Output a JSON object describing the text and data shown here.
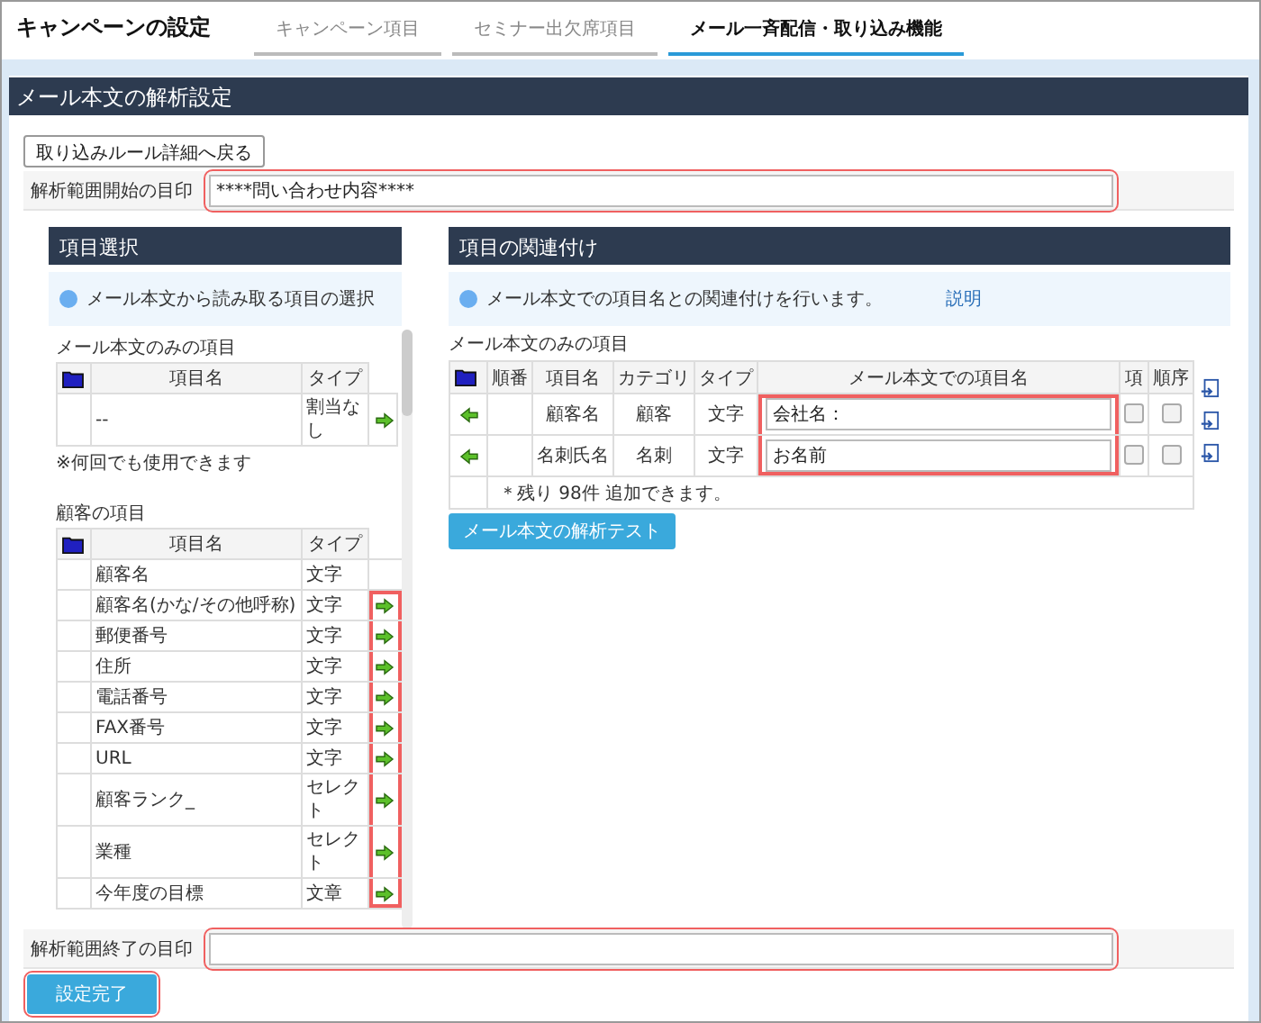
{
  "page_title": "キャンペーンの設定",
  "tabs": [
    {
      "label": "キャンペーン項目",
      "selected": false
    },
    {
      "label": "セミナー出欠席項目",
      "selected": false
    },
    {
      "label": "メール一斉配信・取り込み機能",
      "selected": true
    }
  ],
  "section_title": "メール本文の解析設定",
  "back_button": "取り込みルール詳細へ戻る",
  "start_marker": {
    "label": "解析範囲開始の目印",
    "value": "****問い合わせ内容****",
    "highlighted": true
  },
  "item_selection": {
    "title": "項目選択",
    "info": "メール本文から読み取る項目の選択",
    "mail_only": {
      "heading": "メール本文のみの項目",
      "columns": [
        "項目名",
        "タイプ"
      ],
      "rows": [
        {
          "name": "--",
          "type": "割当なし",
          "arrow": true,
          "highlighted": false
        }
      ],
      "note": "※何回でも使用できます"
    },
    "customer": {
      "heading": "顧客の項目",
      "columns": [
        "項目名",
        "タイプ"
      ],
      "rows": [
        {
          "name": "顧客名",
          "type": "文字",
          "arrow": false,
          "highlighted": false
        },
        {
          "name": "顧客名(かな/その他呼称)",
          "type": "文字",
          "arrow": true,
          "highlighted": true
        },
        {
          "name": "郵便番号",
          "type": "文字",
          "arrow": true,
          "highlighted": true
        },
        {
          "name": "住所",
          "type": "文字",
          "arrow": true,
          "highlighted": true
        },
        {
          "name": "電話番号",
          "type": "文字",
          "arrow": true,
          "highlighted": true
        },
        {
          "name": "FAX番号",
          "type": "文字",
          "arrow": true,
          "highlighted": true
        },
        {
          "name": "URL",
          "type": "文字",
          "arrow": true,
          "highlighted": true
        },
        {
          "name": "顧客ランク_",
          "type": "セレクト",
          "arrow": true,
          "highlighted": true
        },
        {
          "name": "業種",
          "type": "セレクト",
          "arrow": true,
          "highlighted": true
        },
        {
          "name": "今年度の目標",
          "type": "文章",
          "arrow": true,
          "highlighted": true
        }
      ]
    }
  },
  "mapping": {
    "title": "項目の関連付け",
    "info": "メール本文での項目名との関連付けを行います。",
    "help_link": "説明",
    "heading": "メール本文のみの項目",
    "columns": [
      "順番",
      "項目名",
      "カテゴリ",
      "タイプ",
      "メール本文での項目名",
      "項",
      "順序"
    ],
    "rows": [
      {
        "name": "顧客名",
        "category": "顧客",
        "type": "文字",
        "field": "会社名：",
        "item_checked": false,
        "order_checked": false,
        "highlighted": true
      },
      {
        "name": "名刺氏名",
        "category": "名刺",
        "type": "文字",
        "field": "お名前",
        "item_checked": false,
        "order_checked": false,
        "highlighted": true
      }
    ],
    "remaining": "＊残り 98件 追加できます。",
    "test_button": "メール本文の解析テスト"
  },
  "end_marker": {
    "label": "解析範囲終了の目印",
    "highlighted": true
  },
  "complete_button": {
    "label": "設定完了",
    "highlighted": true
  }
}
